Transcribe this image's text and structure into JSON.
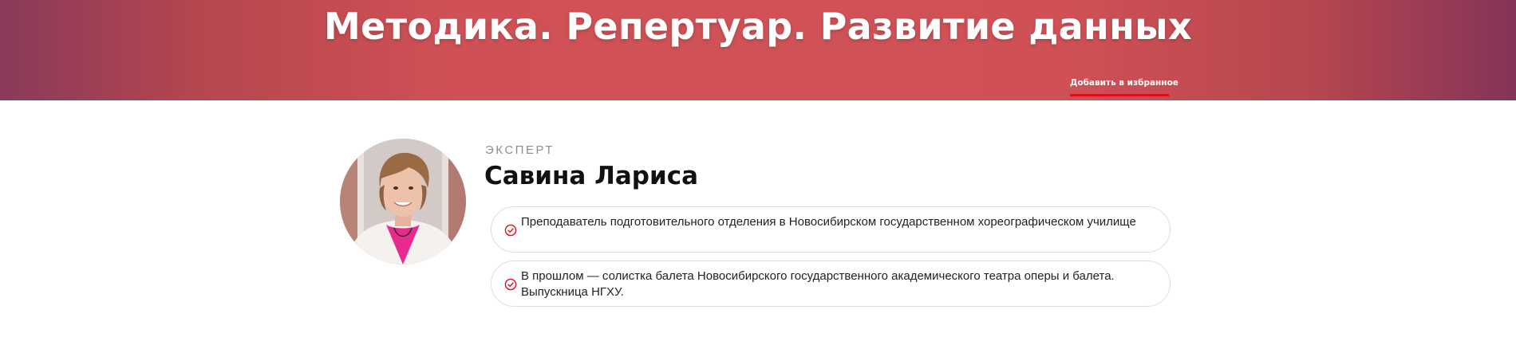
{
  "hero": {
    "title": "Методика. Репертуар. Развитие данных",
    "favorite_link": "Добавить в избранное"
  },
  "expert": {
    "label": "ЭКСПЕРТ",
    "name": "Савина Лариса",
    "avatar_icon": "expert-photo",
    "facts": [
      {
        "icon": "check-circle-icon",
        "text": "Преподаватель подготовительного отделения в Новосибирском государственном хореографическом училище"
      },
      {
        "icon": "check-circle-icon",
        "text": "В прошлом — солистка балета Новосибирского государственного академического театра оперы и балета. Выпускница НГХУ."
      }
    ]
  },
  "colors": {
    "hero_gradient_edge": "#8a3a5a",
    "hero_gradient_center": "#d05257",
    "accent_red": "#e10a1e",
    "border_gray": "#dedede"
  }
}
